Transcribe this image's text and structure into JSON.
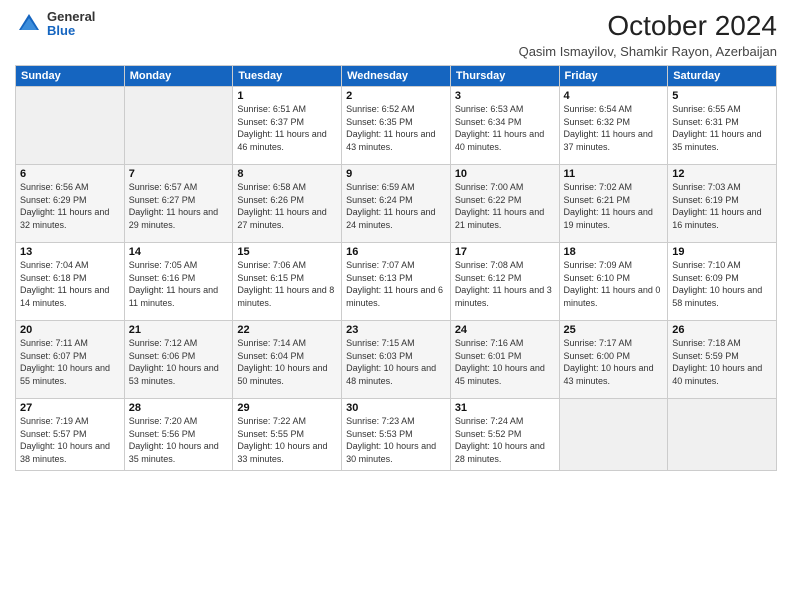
{
  "header": {
    "logo_general": "General",
    "logo_blue": "Blue",
    "month_title": "October 2024",
    "location": "Qasim Ismayilov, Shamkir Rayon, Azerbaijan"
  },
  "weekdays": [
    "Sunday",
    "Monday",
    "Tuesday",
    "Wednesday",
    "Thursday",
    "Friday",
    "Saturday"
  ],
  "weeks": [
    [
      {
        "day": "",
        "info": ""
      },
      {
        "day": "",
        "info": ""
      },
      {
        "day": "1",
        "info": "Sunrise: 6:51 AM\nSunset: 6:37 PM\nDaylight: 11 hours and 46 minutes."
      },
      {
        "day": "2",
        "info": "Sunrise: 6:52 AM\nSunset: 6:35 PM\nDaylight: 11 hours and 43 minutes."
      },
      {
        "day": "3",
        "info": "Sunrise: 6:53 AM\nSunset: 6:34 PM\nDaylight: 11 hours and 40 minutes."
      },
      {
        "day": "4",
        "info": "Sunrise: 6:54 AM\nSunset: 6:32 PM\nDaylight: 11 hours and 37 minutes."
      },
      {
        "day": "5",
        "info": "Sunrise: 6:55 AM\nSunset: 6:31 PM\nDaylight: 11 hours and 35 minutes."
      }
    ],
    [
      {
        "day": "6",
        "info": "Sunrise: 6:56 AM\nSunset: 6:29 PM\nDaylight: 11 hours and 32 minutes."
      },
      {
        "day": "7",
        "info": "Sunrise: 6:57 AM\nSunset: 6:27 PM\nDaylight: 11 hours and 29 minutes."
      },
      {
        "day": "8",
        "info": "Sunrise: 6:58 AM\nSunset: 6:26 PM\nDaylight: 11 hours and 27 minutes."
      },
      {
        "day": "9",
        "info": "Sunrise: 6:59 AM\nSunset: 6:24 PM\nDaylight: 11 hours and 24 minutes."
      },
      {
        "day": "10",
        "info": "Sunrise: 7:00 AM\nSunset: 6:22 PM\nDaylight: 11 hours and 21 minutes."
      },
      {
        "day": "11",
        "info": "Sunrise: 7:02 AM\nSunset: 6:21 PM\nDaylight: 11 hours and 19 minutes."
      },
      {
        "day": "12",
        "info": "Sunrise: 7:03 AM\nSunset: 6:19 PM\nDaylight: 11 hours and 16 minutes."
      }
    ],
    [
      {
        "day": "13",
        "info": "Sunrise: 7:04 AM\nSunset: 6:18 PM\nDaylight: 11 hours and 14 minutes."
      },
      {
        "day": "14",
        "info": "Sunrise: 7:05 AM\nSunset: 6:16 PM\nDaylight: 11 hours and 11 minutes."
      },
      {
        "day": "15",
        "info": "Sunrise: 7:06 AM\nSunset: 6:15 PM\nDaylight: 11 hours and 8 minutes."
      },
      {
        "day": "16",
        "info": "Sunrise: 7:07 AM\nSunset: 6:13 PM\nDaylight: 11 hours and 6 minutes."
      },
      {
        "day": "17",
        "info": "Sunrise: 7:08 AM\nSunset: 6:12 PM\nDaylight: 11 hours and 3 minutes."
      },
      {
        "day": "18",
        "info": "Sunrise: 7:09 AM\nSunset: 6:10 PM\nDaylight: 11 hours and 0 minutes."
      },
      {
        "day": "19",
        "info": "Sunrise: 7:10 AM\nSunset: 6:09 PM\nDaylight: 10 hours and 58 minutes."
      }
    ],
    [
      {
        "day": "20",
        "info": "Sunrise: 7:11 AM\nSunset: 6:07 PM\nDaylight: 10 hours and 55 minutes."
      },
      {
        "day": "21",
        "info": "Sunrise: 7:12 AM\nSunset: 6:06 PM\nDaylight: 10 hours and 53 minutes."
      },
      {
        "day": "22",
        "info": "Sunrise: 7:14 AM\nSunset: 6:04 PM\nDaylight: 10 hours and 50 minutes."
      },
      {
        "day": "23",
        "info": "Sunrise: 7:15 AM\nSunset: 6:03 PM\nDaylight: 10 hours and 48 minutes."
      },
      {
        "day": "24",
        "info": "Sunrise: 7:16 AM\nSunset: 6:01 PM\nDaylight: 10 hours and 45 minutes."
      },
      {
        "day": "25",
        "info": "Sunrise: 7:17 AM\nSunset: 6:00 PM\nDaylight: 10 hours and 43 minutes."
      },
      {
        "day": "26",
        "info": "Sunrise: 7:18 AM\nSunset: 5:59 PM\nDaylight: 10 hours and 40 minutes."
      }
    ],
    [
      {
        "day": "27",
        "info": "Sunrise: 7:19 AM\nSunset: 5:57 PM\nDaylight: 10 hours and 38 minutes."
      },
      {
        "day": "28",
        "info": "Sunrise: 7:20 AM\nSunset: 5:56 PM\nDaylight: 10 hours and 35 minutes."
      },
      {
        "day": "29",
        "info": "Sunrise: 7:22 AM\nSunset: 5:55 PM\nDaylight: 10 hours and 33 minutes."
      },
      {
        "day": "30",
        "info": "Sunrise: 7:23 AM\nSunset: 5:53 PM\nDaylight: 10 hours and 30 minutes."
      },
      {
        "day": "31",
        "info": "Sunrise: 7:24 AM\nSunset: 5:52 PM\nDaylight: 10 hours and 28 minutes."
      },
      {
        "day": "",
        "info": ""
      },
      {
        "day": "",
        "info": ""
      }
    ]
  ]
}
